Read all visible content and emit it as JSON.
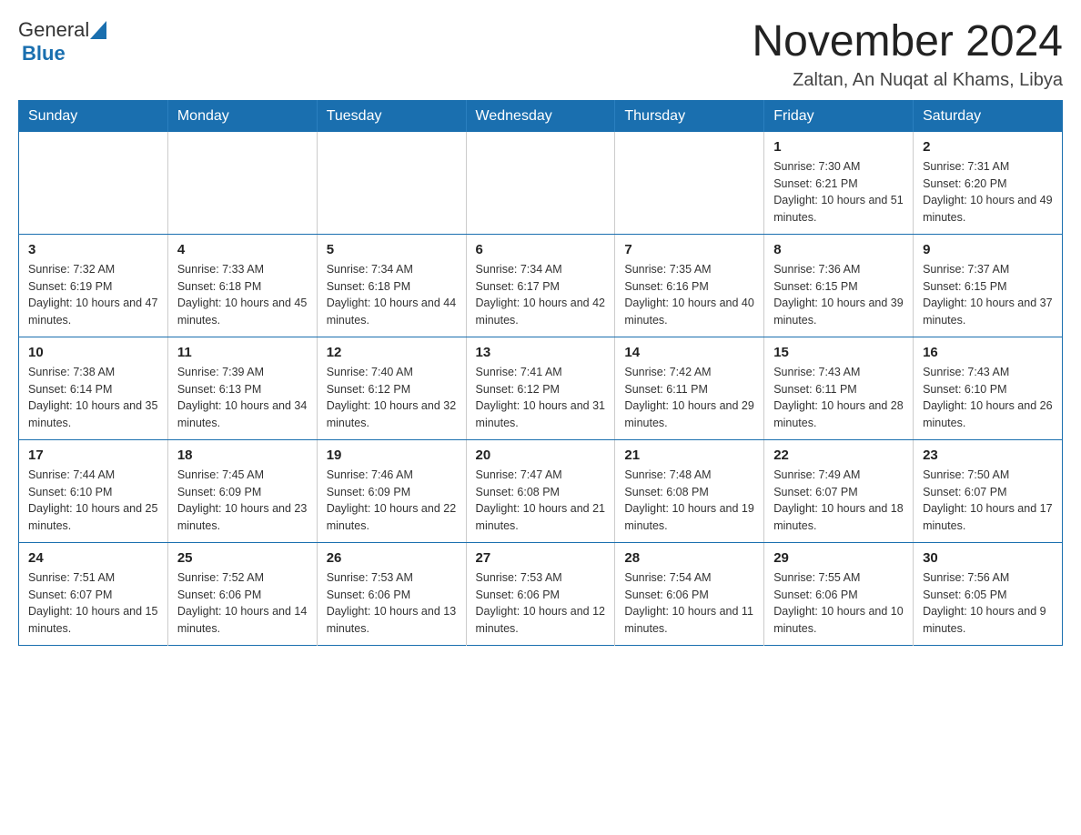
{
  "header": {
    "logo_general": "General",
    "logo_blue": "Blue",
    "month_title": "November 2024",
    "location": "Zaltan, An Nuqat al Khams, Libya"
  },
  "days_of_week": [
    "Sunday",
    "Monday",
    "Tuesday",
    "Wednesday",
    "Thursday",
    "Friday",
    "Saturday"
  ],
  "weeks": [
    [
      {
        "day": "",
        "info": ""
      },
      {
        "day": "",
        "info": ""
      },
      {
        "day": "",
        "info": ""
      },
      {
        "day": "",
        "info": ""
      },
      {
        "day": "",
        "info": ""
      },
      {
        "day": "1",
        "info": "Sunrise: 7:30 AM\nSunset: 6:21 PM\nDaylight: 10 hours and 51 minutes."
      },
      {
        "day": "2",
        "info": "Sunrise: 7:31 AM\nSunset: 6:20 PM\nDaylight: 10 hours and 49 minutes."
      }
    ],
    [
      {
        "day": "3",
        "info": "Sunrise: 7:32 AM\nSunset: 6:19 PM\nDaylight: 10 hours and 47 minutes."
      },
      {
        "day": "4",
        "info": "Sunrise: 7:33 AM\nSunset: 6:18 PM\nDaylight: 10 hours and 45 minutes."
      },
      {
        "day": "5",
        "info": "Sunrise: 7:34 AM\nSunset: 6:18 PM\nDaylight: 10 hours and 44 minutes."
      },
      {
        "day": "6",
        "info": "Sunrise: 7:34 AM\nSunset: 6:17 PM\nDaylight: 10 hours and 42 minutes."
      },
      {
        "day": "7",
        "info": "Sunrise: 7:35 AM\nSunset: 6:16 PM\nDaylight: 10 hours and 40 minutes."
      },
      {
        "day": "8",
        "info": "Sunrise: 7:36 AM\nSunset: 6:15 PM\nDaylight: 10 hours and 39 minutes."
      },
      {
        "day": "9",
        "info": "Sunrise: 7:37 AM\nSunset: 6:15 PM\nDaylight: 10 hours and 37 minutes."
      }
    ],
    [
      {
        "day": "10",
        "info": "Sunrise: 7:38 AM\nSunset: 6:14 PM\nDaylight: 10 hours and 35 minutes."
      },
      {
        "day": "11",
        "info": "Sunrise: 7:39 AM\nSunset: 6:13 PM\nDaylight: 10 hours and 34 minutes."
      },
      {
        "day": "12",
        "info": "Sunrise: 7:40 AM\nSunset: 6:12 PM\nDaylight: 10 hours and 32 minutes."
      },
      {
        "day": "13",
        "info": "Sunrise: 7:41 AM\nSunset: 6:12 PM\nDaylight: 10 hours and 31 minutes."
      },
      {
        "day": "14",
        "info": "Sunrise: 7:42 AM\nSunset: 6:11 PM\nDaylight: 10 hours and 29 minutes."
      },
      {
        "day": "15",
        "info": "Sunrise: 7:43 AM\nSunset: 6:11 PM\nDaylight: 10 hours and 28 minutes."
      },
      {
        "day": "16",
        "info": "Sunrise: 7:43 AM\nSunset: 6:10 PM\nDaylight: 10 hours and 26 minutes."
      }
    ],
    [
      {
        "day": "17",
        "info": "Sunrise: 7:44 AM\nSunset: 6:10 PM\nDaylight: 10 hours and 25 minutes."
      },
      {
        "day": "18",
        "info": "Sunrise: 7:45 AM\nSunset: 6:09 PM\nDaylight: 10 hours and 23 minutes."
      },
      {
        "day": "19",
        "info": "Sunrise: 7:46 AM\nSunset: 6:09 PM\nDaylight: 10 hours and 22 minutes."
      },
      {
        "day": "20",
        "info": "Sunrise: 7:47 AM\nSunset: 6:08 PM\nDaylight: 10 hours and 21 minutes."
      },
      {
        "day": "21",
        "info": "Sunrise: 7:48 AM\nSunset: 6:08 PM\nDaylight: 10 hours and 19 minutes."
      },
      {
        "day": "22",
        "info": "Sunrise: 7:49 AM\nSunset: 6:07 PM\nDaylight: 10 hours and 18 minutes."
      },
      {
        "day": "23",
        "info": "Sunrise: 7:50 AM\nSunset: 6:07 PM\nDaylight: 10 hours and 17 minutes."
      }
    ],
    [
      {
        "day": "24",
        "info": "Sunrise: 7:51 AM\nSunset: 6:07 PM\nDaylight: 10 hours and 15 minutes."
      },
      {
        "day": "25",
        "info": "Sunrise: 7:52 AM\nSunset: 6:06 PM\nDaylight: 10 hours and 14 minutes."
      },
      {
        "day": "26",
        "info": "Sunrise: 7:53 AM\nSunset: 6:06 PM\nDaylight: 10 hours and 13 minutes."
      },
      {
        "day": "27",
        "info": "Sunrise: 7:53 AM\nSunset: 6:06 PM\nDaylight: 10 hours and 12 minutes."
      },
      {
        "day": "28",
        "info": "Sunrise: 7:54 AM\nSunset: 6:06 PM\nDaylight: 10 hours and 11 minutes."
      },
      {
        "day": "29",
        "info": "Sunrise: 7:55 AM\nSunset: 6:06 PM\nDaylight: 10 hours and 10 minutes."
      },
      {
        "day": "30",
        "info": "Sunrise: 7:56 AM\nSunset: 6:05 PM\nDaylight: 10 hours and 9 minutes."
      }
    ]
  ]
}
